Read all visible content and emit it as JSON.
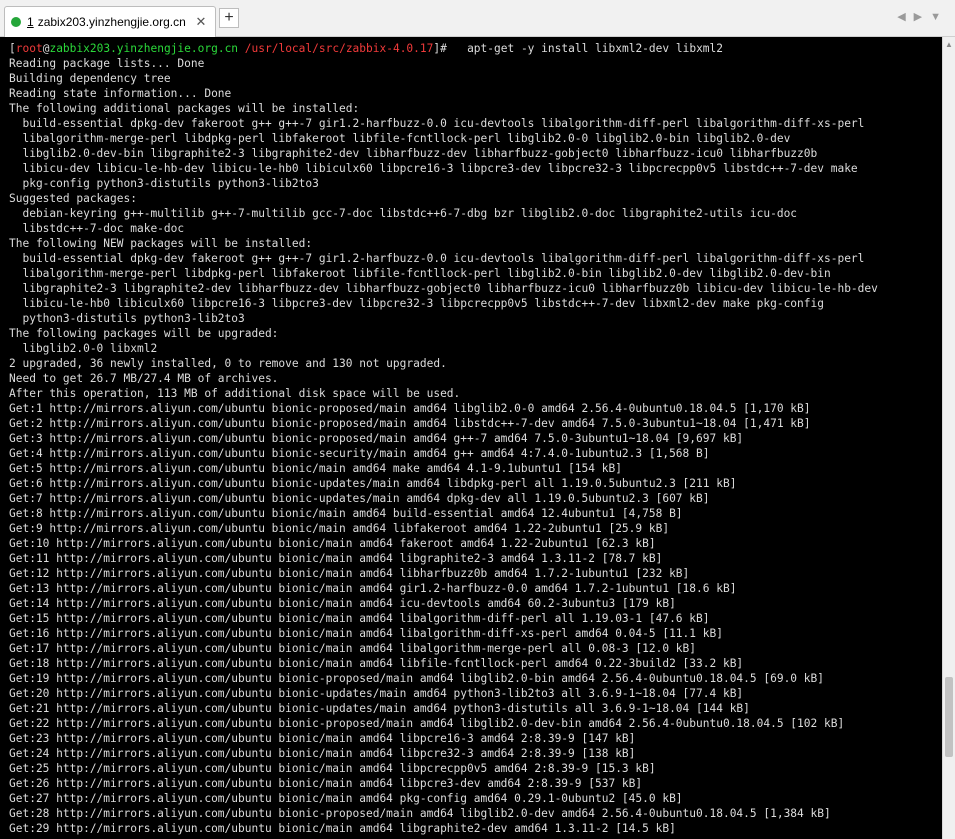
{
  "tab": {
    "number": "1",
    "title": "zabix203.yinzhengjie.org.cn",
    "close_glyph": "✕",
    "new_tab_glyph": "+"
  },
  "nav_arrows": "◀▶▼",
  "prompt": {
    "open": "[",
    "user": "root",
    "at": "@",
    "host": "zabbix203.yinzhengjie.org.cn",
    "path": " /usr/local/src/zabbix-4.0.17",
    "close": "]#",
    "command": "   apt-get -y install libxml2-dev libxml2"
  },
  "output": [
    "Reading package lists... Done",
    "Building dependency tree",
    "Reading state information... Done",
    "The following additional packages will be installed:",
    "  build-essential dpkg-dev fakeroot g++ g++-7 gir1.2-harfbuzz-0.0 icu-devtools libalgorithm-diff-perl libalgorithm-diff-xs-perl",
    "  libalgorithm-merge-perl libdpkg-perl libfakeroot libfile-fcntllock-perl libglib2.0-0 libglib2.0-bin libglib2.0-dev",
    "  libglib2.0-dev-bin libgraphite2-3 libgraphite2-dev libharfbuzz-dev libharfbuzz-gobject0 libharfbuzz-icu0 libharfbuzz0b",
    "  libicu-dev libicu-le-hb-dev libicu-le-hb0 libiculx60 libpcre16-3 libpcre3-dev libpcre32-3 libpcrecpp0v5 libstdc++-7-dev make",
    "  pkg-config python3-distutils python3-lib2to3",
    "Suggested packages:",
    "  debian-keyring g++-multilib g++-7-multilib gcc-7-doc libstdc++6-7-dbg bzr libglib2.0-doc libgraphite2-utils icu-doc",
    "  libstdc++-7-doc make-doc",
    "The following NEW packages will be installed:",
    "  build-essential dpkg-dev fakeroot g++ g++-7 gir1.2-harfbuzz-0.0 icu-devtools libalgorithm-diff-perl libalgorithm-diff-xs-perl",
    "  libalgorithm-merge-perl libdpkg-perl libfakeroot libfile-fcntllock-perl libglib2.0-bin libglib2.0-dev libglib2.0-dev-bin",
    "  libgraphite2-3 libgraphite2-dev libharfbuzz-dev libharfbuzz-gobject0 libharfbuzz-icu0 libharfbuzz0b libicu-dev libicu-le-hb-dev",
    "  libicu-le-hb0 libiculx60 libpcre16-3 libpcre3-dev libpcre32-3 libpcrecpp0v5 libstdc++-7-dev libxml2-dev make pkg-config",
    "  python3-distutils python3-lib2to3",
    "The following packages will be upgraded:",
    "  libglib2.0-0 libxml2",
    "2 upgraded, 36 newly installed, 0 to remove and 130 not upgraded.",
    "Need to get 26.7 MB/27.4 MB of archives.",
    "After this operation, 113 MB of additional disk space will be used.",
    "Get:1 http://mirrors.aliyun.com/ubuntu bionic-proposed/main amd64 libglib2.0-0 amd64 2.56.4-0ubuntu0.18.04.5 [1,170 kB]",
    "Get:2 http://mirrors.aliyun.com/ubuntu bionic-proposed/main amd64 libstdc++-7-dev amd64 7.5.0-3ubuntu1~18.04 [1,471 kB]",
    "Get:3 http://mirrors.aliyun.com/ubuntu bionic-proposed/main amd64 g++-7 amd64 7.5.0-3ubuntu1~18.04 [9,697 kB]",
    "Get:4 http://mirrors.aliyun.com/ubuntu bionic-security/main amd64 g++ amd64 4:7.4.0-1ubuntu2.3 [1,568 B]",
    "Get:5 http://mirrors.aliyun.com/ubuntu bionic/main amd64 make amd64 4.1-9.1ubuntu1 [154 kB]",
    "Get:6 http://mirrors.aliyun.com/ubuntu bionic-updates/main amd64 libdpkg-perl all 1.19.0.5ubuntu2.3 [211 kB]",
    "Get:7 http://mirrors.aliyun.com/ubuntu bionic-updates/main amd64 dpkg-dev all 1.19.0.5ubuntu2.3 [607 kB]",
    "Get:8 http://mirrors.aliyun.com/ubuntu bionic/main amd64 build-essential amd64 12.4ubuntu1 [4,758 B]",
    "Get:9 http://mirrors.aliyun.com/ubuntu bionic/main amd64 libfakeroot amd64 1.22-2ubuntu1 [25.9 kB]",
    "Get:10 http://mirrors.aliyun.com/ubuntu bionic/main amd64 fakeroot amd64 1.22-2ubuntu1 [62.3 kB]",
    "Get:11 http://mirrors.aliyun.com/ubuntu bionic/main amd64 libgraphite2-3 amd64 1.3.11-2 [78.7 kB]",
    "Get:12 http://mirrors.aliyun.com/ubuntu bionic/main amd64 libharfbuzz0b amd64 1.7.2-1ubuntu1 [232 kB]",
    "Get:13 http://mirrors.aliyun.com/ubuntu bionic/main amd64 gir1.2-harfbuzz-0.0 amd64 1.7.2-1ubuntu1 [18.6 kB]",
    "Get:14 http://mirrors.aliyun.com/ubuntu bionic/main amd64 icu-devtools amd64 60.2-3ubuntu3 [179 kB]",
    "Get:15 http://mirrors.aliyun.com/ubuntu bionic/main amd64 libalgorithm-diff-perl all 1.19.03-1 [47.6 kB]",
    "Get:16 http://mirrors.aliyun.com/ubuntu bionic/main amd64 libalgorithm-diff-xs-perl amd64 0.04-5 [11.1 kB]",
    "Get:17 http://mirrors.aliyun.com/ubuntu bionic/main amd64 libalgorithm-merge-perl all 0.08-3 [12.0 kB]",
    "Get:18 http://mirrors.aliyun.com/ubuntu bionic/main amd64 libfile-fcntllock-perl amd64 0.22-3build2 [33.2 kB]",
    "Get:19 http://mirrors.aliyun.com/ubuntu bionic-proposed/main amd64 libglib2.0-bin amd64 2.56.4-0ubuntu0.18.04.5 [69.0 kB]",
    "Get:20 http://mirrors.aliyun.com/ubuntu bionic-updates/main amd64 python3-lib2to3 all 3.6.9-1~18.04 [77.4 kB]",
    "Get:21 http://mirrors.aliyun.com/ubuntu bionic-updates/main amd64 python3-distutils all 3.6.9-1~18.04 [144 kB]",
    "Get:22 http://mirrors.aliyun.com/ubuntu bionic-proposed/main amd64 libglib2.0-dev-bin amd64 2.56.4-0ubuntu0.18.04.5 [102 kB]",
    "Get:23 http://mirrors.aliyun.com/ubuntu bionic/main amd64 libpcre16-3 amd64 2:8.39-9 [147 kB]",
    "Get:24 http://mirrors.aliyun.com/ubuntu bionic/main amd64 libpcre32-3 amd64 2:8.39-9 [138 kB]",
    "Get:25 http://mirrors.aliyun.com/ubuntu bionic/main amd64 libpcrecpp0v5 amd64 2:8.39-9 [15.3 kB]",
    "Get:26 http://mirrors.aliyun.com/ubuntu bionic/main amd64 libpcre3-dev amd64 2:8.39-9 [537 kB]",
    "Get:27 http://mirrors.aliyun.com/ubuntu bionic/main amd64 pkg-config amd64 0.29.1-0ubuntu2 [45.0 kB]",
    "Get:28 http://mirrors.aliyun.com/ubuntu bionic-proposed/main amd64 libglib2.0-dev amd64 2.56.4-0ubuntu0.18.04.5 [1,384 kB]",
    "Get:29 http://mirrors.aliyun.com/ubuntu bionic/main amd64 libgraphite2-dev amd64 1.3.11-2 [14.5 kB]"
  ]
}
